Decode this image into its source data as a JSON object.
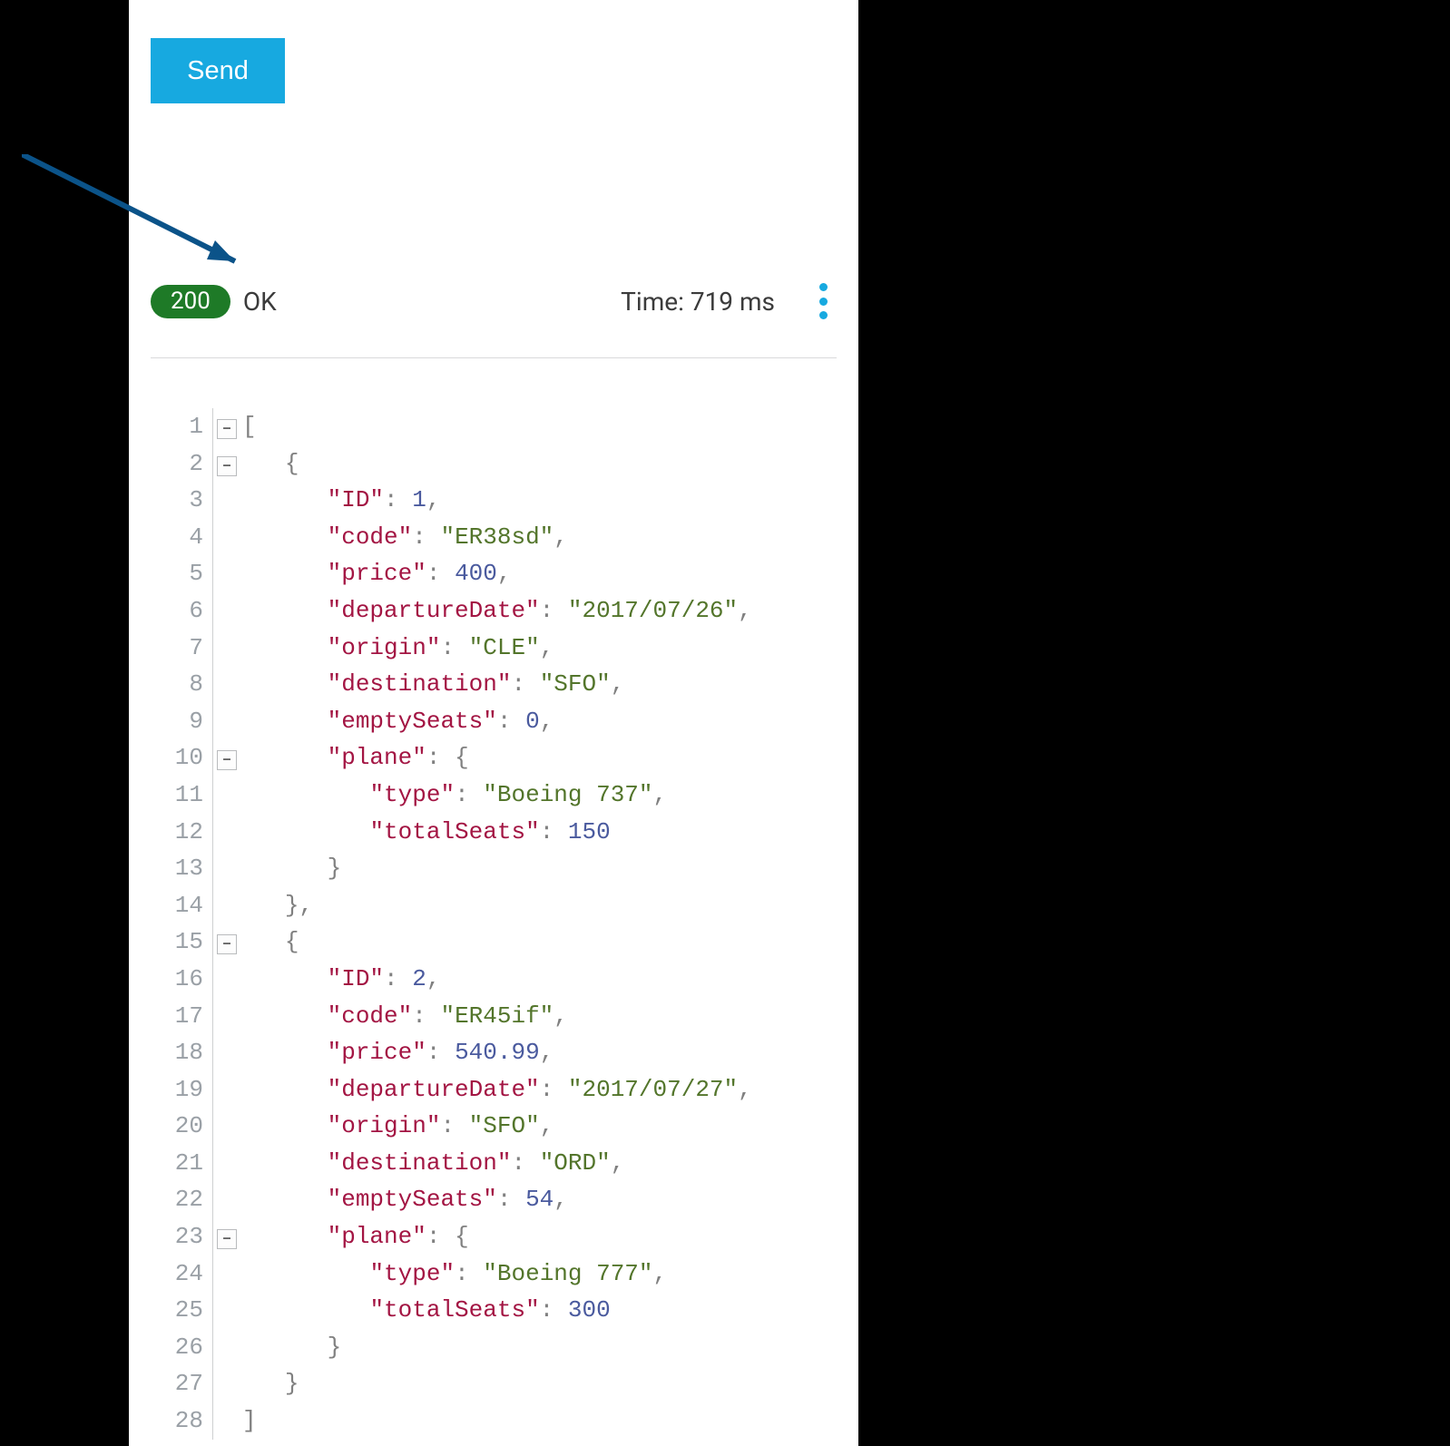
{
  "send_label": "Send",
  "status": {
    "code": "200",
    "text": "OK"
  },
  "time": {
    "label": "Time: ",
    "value": "719 ms"
  },
  "fold_glyph": "–",
  "response_json": [
    {
      "ID": 1,
      "code": "ER38sd",
      "price": 400,
      "departureDate": "2017/07/26",
      "origin": "CLE",
      "destination": "SFO",
      "emptySeats": 0,
      "plane": {
        "type": "Boeing 737",
        "totalSeats": 150
      }
    },
    {
      "ID": 2,
      "code": "ER45if",
      "price": 540.99,
      "departureDate": "2017/07/27",
      "origin": "SFO",
      "destination": "ORD",
      "emptySeats": 54,
      "plane": {
        "type": "Boeing 777",
        "totalSeats": 300
      }
    }
  ],
  "code_lines": [
    {
      "n": 1,
      "fold": true,
      "indent": 0,
      "tokens": [
        {
          "t": "[",
          "c": "punc"
        }
      ]
    },
    {
      "n": 2,
      "fold": true,
      "indent": 1,
      "tokens": [
        {
          "t": "{",
          "c": "punc"
        }
      ]
    },
    {
      "n": 3,
      "fold": false,
      "indent": 2,
      "tokens": [
        {
          "t": "\"ID\"",
          "c": "key"
        },
        {
          "t": ": ",
          "c": "punc"
        },
        {
          "t": "1",
          "c": "num"
        },
        {
          "t": ",",
          "c": "punc"
        }
      ]
    },
    {
      "n": 4,
      "fold": false,
      "indent": 2,
      "tokens": [
        {
          "t": "\"code\"",
          "c": "key"
        },
        {
          "t": ": ",
          "c": "punc"
        },
        {
          "t": "\"ER38sd\"",
          "c": "str"
        },
        {
          "t": ",",
          "c": "punc"
        }
      ]
    },
    {
      "n": 5,
      "fold": false,
      "indent": 2,
      "tokens": [
        {
          "t": "\"price\"",
          "c": "key"
        },
        {
          "t": ": ",
          "c": "punc"
        },
        {
          "t": "400",
          "c": "num"
        },
        {
          "t": ",",
          "c": "punc"
        }
      ]
    },
    {
      "n": 6,
      "fold": false,
      "indent": 2,
      "tokens": [
        {
          "t": "\"departureDate\"",
          "c": "key"
        },
        {
          "t": ": ",
          "c": "punc"
        },
        {
          "t": "\"2017/07/26\"",
          "c": "str"
        },
        {
          "t": ",",
          "c": "punc"
        }
      ]
    },
    {
      "n": 7,
      "fold": false,
      "indent": 2,
      "tokens": [
        {
          "t": "\"origin\"",
          "c": "key"
        },
        {
          "t": ": ",
          "c": "punc"
        },
        {
          "t": "\"CLE\"",
          "c": "str"
        },
        {
          "t": ",",
          "c": "punc"
        }
      ]
    },
    {
      "n": 8,
      "fold": false,
      "indent": 2,
      "tokens": [
        {
          "t": "\"destination\"",
          "c": "key"
        },
        {
          "t": ": ",
          "c": "punc"
        },
        {
          "t": "\"SFO\"",
          "c": "str"
        },
        {
          "t": ",",
          "c": "punc"
        }
      ]
    },
    {
      "n": 9,
      "fold": false,
      "indent": 2,
      "tokens": [
        {
          "t": "\"emptySeats\"",
          "c": "key"
        },
        {
          "t": ": ",
          "c": "punc"
        },
        {
          "t": "0",
          "c": "num"
        },
        {
          "t": ",",
          "c": "punc"
        }
      ]
    },
    {
      "n": 10,
      "fold": true,
      "indent": 2,
      "tokens": [
        {
          "t": "\"plane\"",
          "c": "key"
        },
        {
          "t": ": ",
          "c": "punc"
        },
        {
          "t": "{",
          "c": "punc"
        }
      ]
    },
    {
      "n": 11,
      "fold": false,
      "indent": 3,
      "tokens": [
        {
          "t": "\"type\"",
          "c": "key"
        },
        {
          "t": ": ",
          "c": "punc"
        },
        {
          "t": "\"Boeing 737\"",
          "c": "str"
        },
        {
          "t": ",",
          "c": "punc"
        }
      ]
    },
    {
      "n": 12,
      "fold": false,
      "indent": 3,
      "tokens": [
        {
          "t": "\"totalSeats\"",
          "c": "key"
        },
        {
          "t": ": ",
          "c": "punc"
        },
        {
          "t": "150",
          "c": "num"
        }
      ]
    },
    {
      "n": 13,
      "fold": false,
      "indent": 2,
      "tokens": [
        {
          "t": "}",
          "c": "punc"
        }
      ]
    },
    {
      "n": 14,
      "fold": false,
      "indent": 1,
      "tokens": [
        {
          "t": "},",
          "c": "punc"
        }
      ]
    },
    {
      "n": 15,
      "fold": true,
      "indent": 1,
      "tokens": [
        {
          "t": "{",
          "c": "punc"
        }
      ]
    },
    {
      "n": 16,
      "fold": false,
      "indent": 2,
      "tokens": [
        {
          "t": "\"ID\"",
          "c": "key"
        },
        {
          "t": ": ",
          "c": "punc"
        },
        {
          "t": "2",
          "c": "num"
        },
        {
          "t": ",",
          "c": "punc"
        }
      ]
    },
    {
      "n": 17,
      "fold": false,
      "indent": 2,
      "tokens": [
        {
          "t": "\"code\"",
          "c": "key"
        },
        {
          "t": ": ",
          "c": "punc"
        },
        {
          "t": "\"ER45if\"",
          "c": "str"
        },
        {
          "t": ",",
          "c": "punc"
        }
      ]
    },
    {
      "n": 18,
      "fold": false,
      "indent": 2,
      "tokens": [
        {
          "t": "\"price\"",
          "c": "key"
        },
        {
          "t": ": ",
          "c": "punc"
        },
        {
          "t": "540.99",
          "c": "num"
        },
        {
          "t": ",",
          "c": "punc"
        }
      ]
    },
    {
      "n": 19,
      "fold": false,
      "indent": 2,
      "tokens": [
        {
          "t": "\"departureDate\"",
          "c": "key"
        },
        {
          "t": ": ",
          "c": "punc"
        },
        {
          "t": "\"2017/07/27\"",
          "c": "str"
        },
        {
          "t": ",",
          "c": "punc"
        }
      ]
    },
    {
      "n": 20,
      "fold": false,
      "indent": 2,
      "tokens": [
        {
          "t": "\"origin\"",
          "c": "key"
        },
        {
          "t": ": ",
          "c": "punc"
        },
        {
          "t": "\"SFO\"",
          "c": "str"
        },
        {
          "t": ",",
          "c": "punc"
        }
      ]
    },
    {
      "n": 21,
      "fold": false,
      "indent": 2,
      "tokens": [
        {
          "t": "\"destination\"",
          "c": "key"
        },
        {
          "t": ": ",
          "c": "punc"
        },
        {
          "t": "\"ORD\"",
          "c": "str"
        },
        {
          "t": ",",
          "c": "punc"
        }
      ]
    },
    {
      "n": 22,
      "fold": false,
      "indent": 2,
      "tokens": [
        {
          "t": "\"emptySeats\"",
          "c": "key"
        },
        {
          "t": ": ",
          "c": "punc"
        },
        {
          "t": "54",
          "c": "num"
        },
        {
          "t": ",",
          "c": "punc"
        }
      ]
    },
    {
      "n": 23,
      "fold": true,
      "indent": 2,
      "tokens": [
        {
          "t": "\"plane\"",
          "c": "key"
        },
        {
          "t": ": ",
          "c": "punc"
        },
        {
          "t": "{",
          "c": "punc"
        }
      ]
    },
    {
      "n": 24,
      "fold": false,
      "indent": 3,
      "tokens": [
        {
          "t": "\"type\"",
          "c": "key"
        },
        {
          "t": ": ",
          "c": "punc"
        },
        {
          "t": "\"Boeing 777\"",
          "c": "str"
        },
        {
          "t": ",",
          "c": "punc"
        }
      ]
    },
    {
      "n": 25,
      "fold": false,
      "indent": 3,
      "tokens": [
        {
          "t": "\"totalSeats\"",
          "c": "key"
        },
        {
          "t": ": ",
          "c": "punc"
        },
        {
          "t": "300",
          "c": "num"
        }
      ]
    },
    {
      "n": 26,
      "fold": false,
      "indent": 2,
      "tokens": [
        {
          "t": "}",
          "c": "punc"
        }
      ]
    },
    {
      "n": 27,
      "fold": false,
      "indent": 1,
      "tokens": [
        {
          "t": "}",
          "c": "punc"
        }
      ]
    },
    {
      "n": 28,
      "fold": false,
      "indent": 0,
      "tokens": [
        {
          "t": "]",
          "c": "punc"
        }
      ]
    }
  ]
}
